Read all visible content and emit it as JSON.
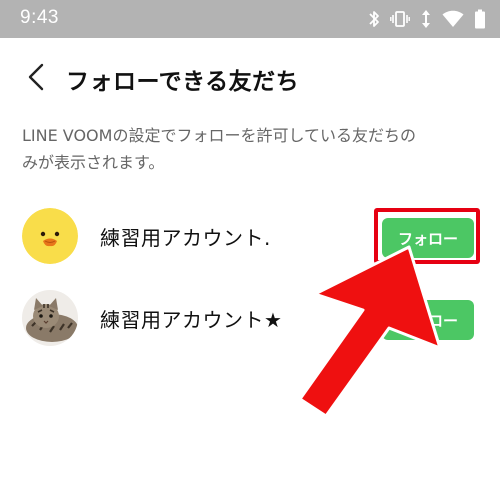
{
  "statusbar": {
    "time": "9:43",
    "icons": [
      "bluetooth-icon",
      "vibrate-icon",
      "data-arrows-icon",
      "wifi-icon",
      "battery-icon"
    ]
  },
  "header": {
    "back_icon": "chevron-left-icon",
    "title": "フォローできる友だち"
  },
  "description": {
    "line1": "LINE VOOMの設定でフォローを許可している友だちの",
    "line2": "みが表示されます。"
  },
  "friends": [
    {
      "name": "練習用アカウント.",
      "avatar": "sally-chick-avatar",
      "button_label": "フォロー"
    },
    {
      "name": "練習用アカウント★",
      "avatar": "cat-photo-avatar",
      "button_label": "フォロー"
    }
  ],
  "colors": {
    "statusbar": "#b3b3b3",
    "follow_button": "#4cc764",
    "highlight": "#e60012"
  }
}
